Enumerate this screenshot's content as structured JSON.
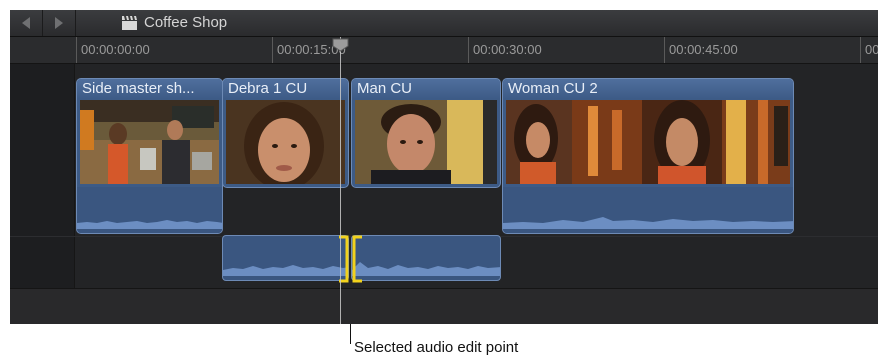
{
  "titlebar": {
    "back_icon": "back-arrow-icon",
    "forward_icon": "forward-arrow-icon",
    "project_icon": "clapperboard-icon",
    "project_title": "Coffee Shop"
  },
  "ruler": {
    "timecodes": [
      "00:00:00:00",
      "00:00:15:00",
      "00:00:30:00",
      "00:00:45:00",
      "00"
    ]
  },
  "clips": [
    {
      "name": "Side master sh..."
    },
    {
      "name": "Debra 1 CU"
    },
    {
      "name": "Man CU"
    },
    {
      "name": "Woman CU 2"
    }
  ],
  "annotation": {
    "callout_text": "Selected audio edit point"
  },
  "colors": {
    "clip_fill": "#3d5b86",
    "clip_border": "#6d8ab5",
    "edit_point_selected": "#f2d21c"
  }
}
